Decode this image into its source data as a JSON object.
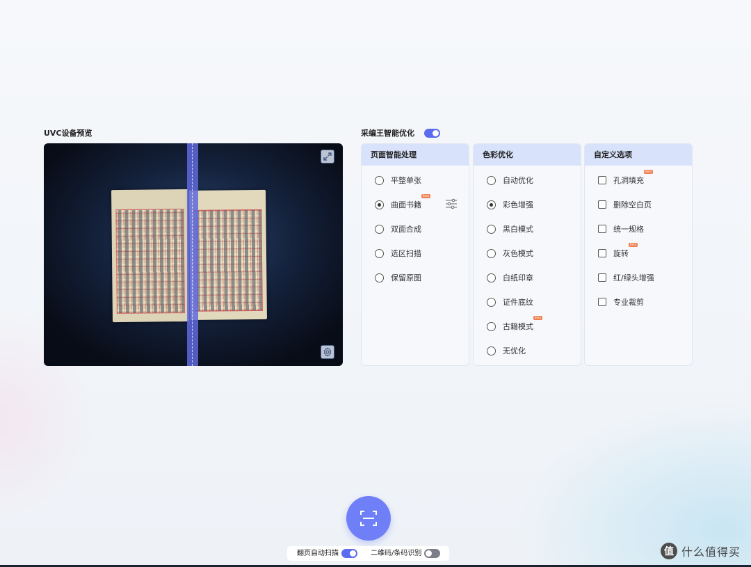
{
  "preview": {
    "title": "UVC设备预览",
    "expand_icon": "expand-icon",
    "settings_icon": "gear-icon"
  },
  "optimize": {
    "title": "采编王智能优化",
    "enabled": true,
    "columns": [
      {
        "title": "页面智能处理",
        "type": "radio",
        "items": [
          {
            "label": "平整单张",
            "selected": false
          },
          {
            "label": "曲面书籍",
            "selected": true,
            "badge": "Beta"
          },
          {
            "label": "双面合成",
            "selected": false
          },
          {
            "label": "选区扫描",
            "selected": false
          },
          {
            "label": "保留原图",
            "selected": false
          }
        ]
      },
      {
        "title": "色彩优化",
        "type": "radio",
        "items": [
          {
            "label": "自动优化",
            "selected": false
          },
          {
            "label": "彩色增强",
            "selected": true
          },
          {
            "label": "黑白模式",
            "selected": false
          },
          {
            "label": "灰色模式",
            "selected": false
          },
          {
            "label": "白纸印章",
            "selected": false
          },
          {
            "label": "证件底纹",
            "selected": false
          },
          {
            "label": "古籍模式",
            "selected": false,
            "badge": "Beta"
          },
          {
            "label": "无优化",
            "selected": false
          }
        ]
      },
      {
        "title": "自定义选项",
        "type": "checkbox",
        "items": [
          {
            "label": "孔洞填充",
            "checked": false,
            "badge": "Beta"
          },
          {
            "label": "删除空白页",
            "checked": false
          },
          {
            "label": "统一规格",
            "checked": false
          },
          {
            "label": "旋转",
            "checked": false,
            "badge": "Beta"
          },
          {
            "label": "红/绿头增强",
            "checked": false
          },
          {
            "label": "专业裁剪",
            "checked": false
          }
        ]
      }
    ]
  },
  "bottom": {
    "scan_icon": "scan-icon",
    "auto_scan_label": "翻页自动扫描",
    "auto_scan_on": true,
    "barcode_label": "二维码/条码识别",
    "barcode_on": false
  },
  "watermark": {
    "logo": "值",
    "text": "什么值得买"
  },
  "colors": {
    "accent": "#5c6cf0",
    "column_header": "#d8e2fb",
    "badge": "#ef7d4e"
  }
}
